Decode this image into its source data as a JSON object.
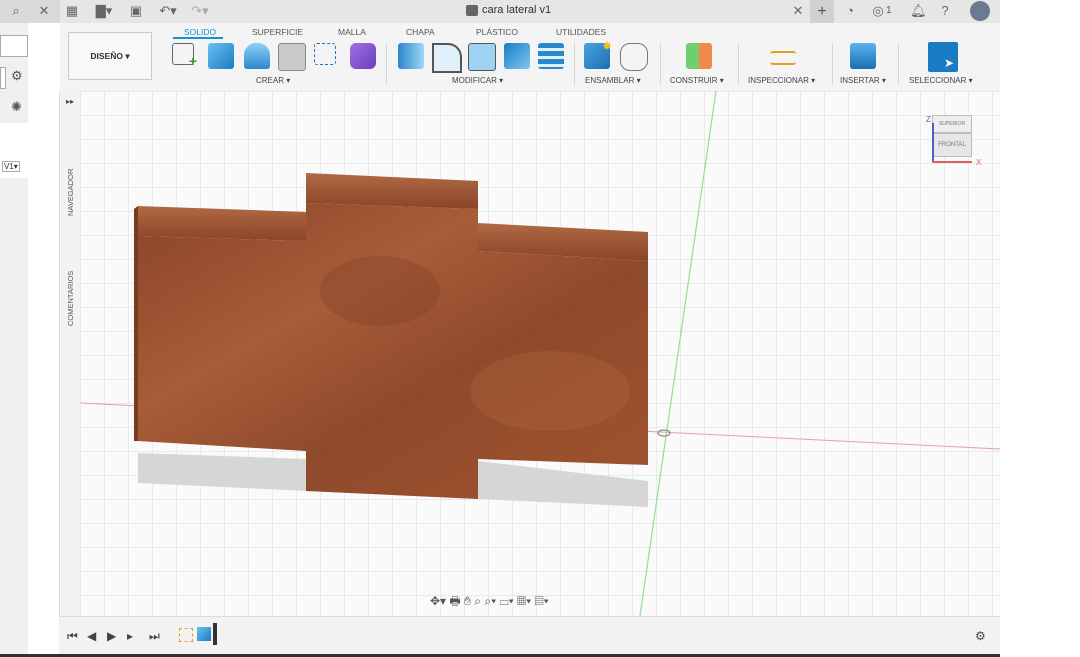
{
  "window": {
    "title": "cara lateral v1"
  },
  "toolbar": {
    "workspace": "DISEÑO ▾",
    "tabs": [
      "SOLIDO",
      "SUPERFICIE",
      "MALLA",
      "CHAPA",
      "PLÁSTICO",
      "UTILIDADES"
    ],
    "groups": [
      "CREAR ▾",
      "MODIFICAR ▾",
      "ENSAMBLAR ▾",
      "CONSTRUIR ▾",
      "INSPECCIONAR ▾",
      "INSERTAR ▾",
      "SELECCIONAR ▾"
    ]
  },
  "topbar": {
    "job_count": "1"
  },
  "left_panel": {
    "version": "V1▾"
  },
  "sidebar": {
    "navigator": "NAVEGADOR",
    "comments": "COMENTARIOS"
  },
  "viewcube": {
    "top": "SUPERIOR",
    "front": "FRONTAL",
    "z_axis": "Z",
    "x_axis": "X"
  },
  "icons": [
    "search-icon",
    "close-icon",
    "grid-icon",
    "file-icon",
    "save-icon",
    "undo-icon",
    "redo-icon",
    "add-tab-icon",
    "extensions-icon",
    "clock-icon",
    "bell-icon",
    "help-icon",
    "avatar-icon",
    "gear-icon",
    "render-icon",
    "play-icon",
    "step-back-icon",
    "step-forward-icon",
    "first-icon",
    "last-icon"
  ],
  "colors": {
    "accent": "#1a8fd4",
    "wood": "#9a5030",
    "axis_red": "#e06060",
    "axis_green": "#6fd66f"
  }
}
